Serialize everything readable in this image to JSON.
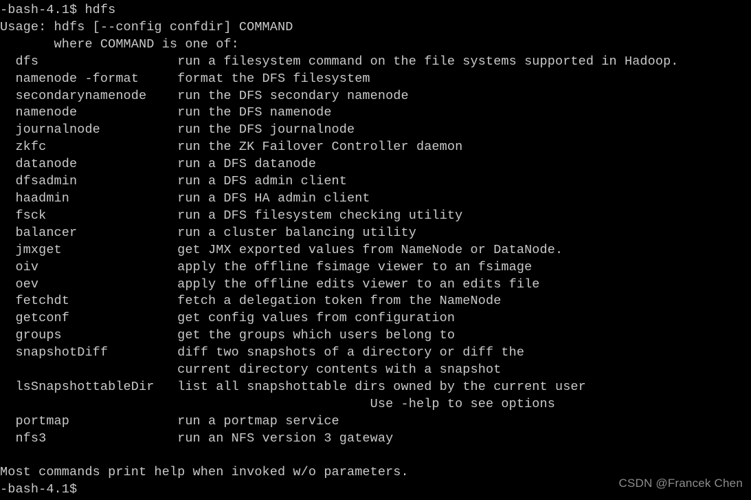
{
  "terminal": {
    "prompt": "-bash-4.1$",
    "typed_command": "hdfs",
    "char_columns": {
      "command_col": 2,
      "description_col": 23
    },
    "colors": {
      "background": "#000000",
      "foreground": "#c9c9c9",
      "watermark": "#8c8c8c"
    },
    "lines": [
      "-bash-4.1$ hdfs",
      "Usage: hdfs [--config confdir] COMMAND",
      "       where COMMAND is one of:",
      "  dfs                  run a filesystem command on the file systems supported in Hadoop.",
      "  namenode -format     format the DFS filesystem",
      "  secondarynamenode    run the DFS secondary namenode",
      "  namenode             run the DFS namenode",
      "  journalnode          run the DFS journalnode",
      "  zkfc                 run the ZK Failover Controller daemon",
      "  datanode             run a DFS datanode",
      "  dfsadmin             run a DFS admin client",
      "  haadmin              run a DFS HA admin client",
      "  fsck                 run a DFS filesystem checking utility",
      "  balancer             run a cluster balancing utility",
      "  jmxget               get JMX exported values from NameNode or DataNode.",
      "  oiv                  apply the offline fsimage viewer to an fsimage",
      "  oev                  apply the offline edits viewer to an edits file",
      "  fetchdt              fetch a delegation token from the NameNode",
      "  getconf              get config values from configuration",
      "  groups               get the groups which users belong to",
      "  snapshotDiff         diff two snapshots of a directory or diff the",
      "                       current directory contents with a snapshot",
      "  lsSnapshottableDir   list all snapshottable dirs owned by the current user",
      "                                                Use -help to see options",
      "  portmap              run a portmap service",
      "  nfs3                 run an NFS version 3 gateway",
      "",
      "Most commands print help when invoked w/o parameters.",
      "-bash-4.1$"
    ]
  },
  "watermark": {
    "text": "CSDN @Francek Chen"
  }
}
